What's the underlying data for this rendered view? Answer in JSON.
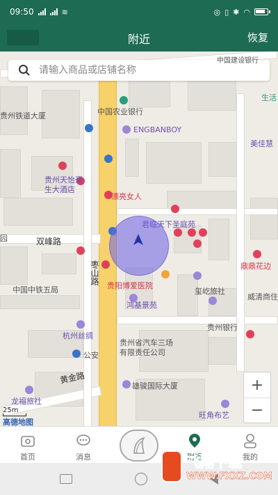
{
  "status_bar": {
    "time": "09:50"
  },
  "header": {
    "title": "附近",
    "right_action": "恢复"
  },
  "search": {
    "placeholder": "请输入商品或店铺名称"
  },
  "map": {
    "labels": {
      "railway_building": "贵州铁道大厦",
      "agri_bank": "中国农业银行",
      "engbanboy": "ENGBANBOY",
      "hotel_line1": "贵州天怡豪",
      "hotel_line2": "生大酒店",
      "beauty": "漂亮女人",
      "junlin": "君临天下圣庭苑",
      "shuangfeng_road": "双峰路",
      "zaoshan_road": "枣山路",
      "zhongtie": "中国中铁五局",
      "hospital": "贵阳博爱医院",
      "hangzhou_silk": "杭州丝绸",
      "gongan": "公安",
      "hongji": "鸿基景苑",
      "auto_three_line1": "贵州省汽车三场",
      "auto_three_line2": "有限责任公司",
      "guizhou_bank": "贵州银行",
      "weiling": "玺屹旅社",
      "weiqing": "威清商住",
      "dinghui": "鼎鼎花边",
      "shenghuo": "生活",
      "meijia": "美佳慧",
      "huangjin_road": "黄金路",
      "longfu": "龙福旅社",
      "xiongjun": "雄骏国际大厦",
      "wangjiao": "旺角布艺",
      "jianshe_bank": "中国建设银行",
      "yuan": "园"
    },
    "scale": "25m",
    "logo": "高德地图",
    "zoom_in": "+",
    "zoom_out": "−"
  },
  "tabs": [
    {
      "label": "首页",
      "icon": "home-icon"
    },
    {
      "label": "消息",
      "icon": "message-icon"
    },
    {
      "label": "",
      "icon": "center-logo-icon"
    },
    {
      "label": "附近",
      "icon": "location-pin-icon"
    },
    {
      "label": "我的",
      "icon": "user-icon"
    }
  ],
  "watermark": {
    "title": "飞翔下载",
    "url": "WWW.FXXZ.COM"
  },
  "colors": {
    "brand": "#1d6b52",
    "location_circle": "#6c60e6",
    "road_main": "#f7d26a"
  }
}
